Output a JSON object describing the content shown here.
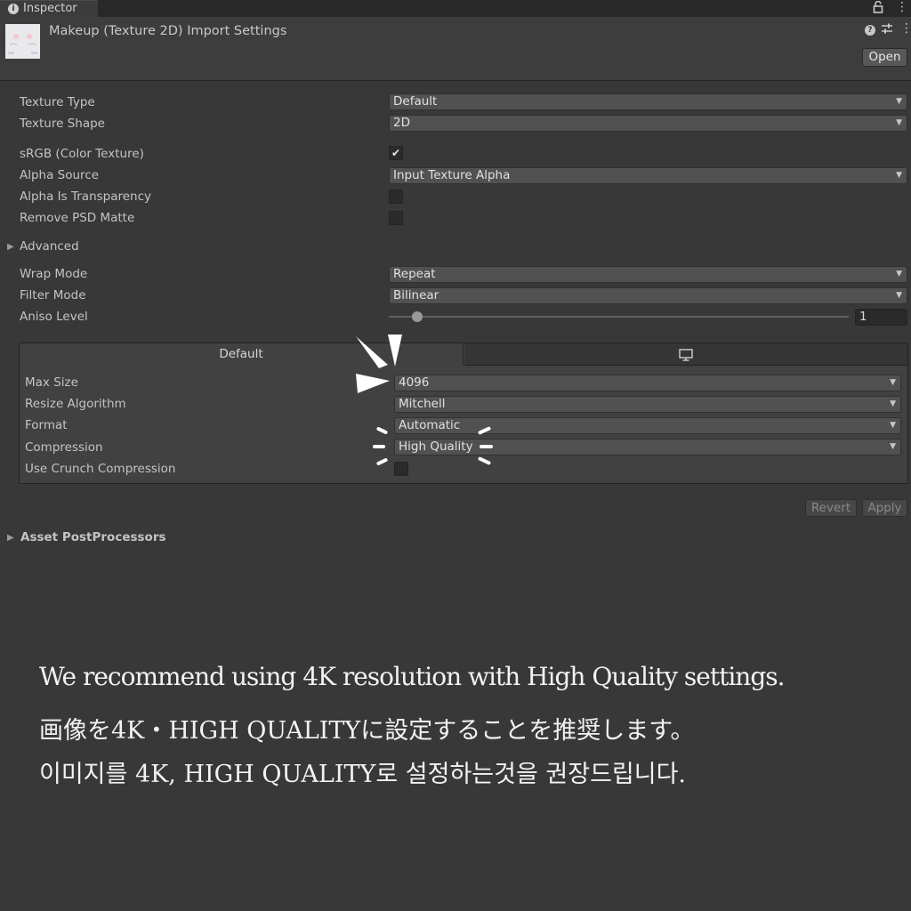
{
  "window": {
    "tab_label": "Inspector",
    "tab_icon": "info-icon",
    "lock_icon": "lock-icon",
    "menu_icon": "kebab-menu-icon"
  },
  "header": {
    "title": "Makeup (Texture 2D) Import Settings",
    "open_label": "Open",
    "icons": [
      "help-icon",
      "preset-icon",
      "kebab-menu-icon"
    ]
  },
  "settings": {
    "texture_type": {
      "label": "Texture Type",
      "value": "Default"
    },
    "texture_shape": {
      "label": "Texture Shape",
      "value": "2D"
    },
    "srgb": {
      "label": "sRGB (Color Texture)",
      "checked": true
    },
    "alpha_source": {
      "label": "Alpha Source",
      "value": "Input Texture Alpha"
    },
    "alpha_is_transparency": {
      "label": "Alpha Is Transparency",
      "checked": false
    },
    "remove_psd_matte": {
      "label": "Remove PSD Matte",
      "checked": false
    },
    "advanced": {
      "label": "Advanced"
    },
    "wrap_mode": {
      "label": "Wrap Mode",
      "value": "Repeat"
    },
    "filter_mode": {
      "label": "Filter Mode",
      "value": "Bilinear"
    },
    "aniso_level": {
      "label": "Aniso Level",
      "value": "1",
      "slider_fraction": 0.0625
    }
  },
  "platform": {
    "tabs": [
      {
        "label": "Default",
        "active": true
      },
      {
        "icon": "monitor-icon",
        "active": false
      }
    ],
    "max_size": {
      "label": "Max Size",
      "value": "4096"
    },
    "resize_algorithm": {
      "label": "Resize Algorithm",
      "value": "Mitchell"
    },
    "format": {
      "label": "Format",
      "value": "Automatic"
    },
    "compression": {
      "label": "Compression",
      "value": "High Quality"
    },
    "crunch": {
      "label": "Use Crunch Compression",
      "checked": false
    }
  },
  "footer": {
    "revert_label": "Revert",
    "apply_label": "Apply",
    "asset_postprocessors": "Asset PostProcessors"
  },
  "caption": {
    "en": "We recommend using 4K resolution with High Quality settings.",
    "ja": "画像を4K・HIGH QUALITYに設定することを推奨します。",
    "ko": "이미지를 4K, HIGH QUALITY로 설정하는것을 권장드립니다."
  },
  "colors": {
    "background": "#383838",
    "header": "#3d3d3d",
    "field": "#515151",
    "accent_text": "#f2f2f2"
  }
}
